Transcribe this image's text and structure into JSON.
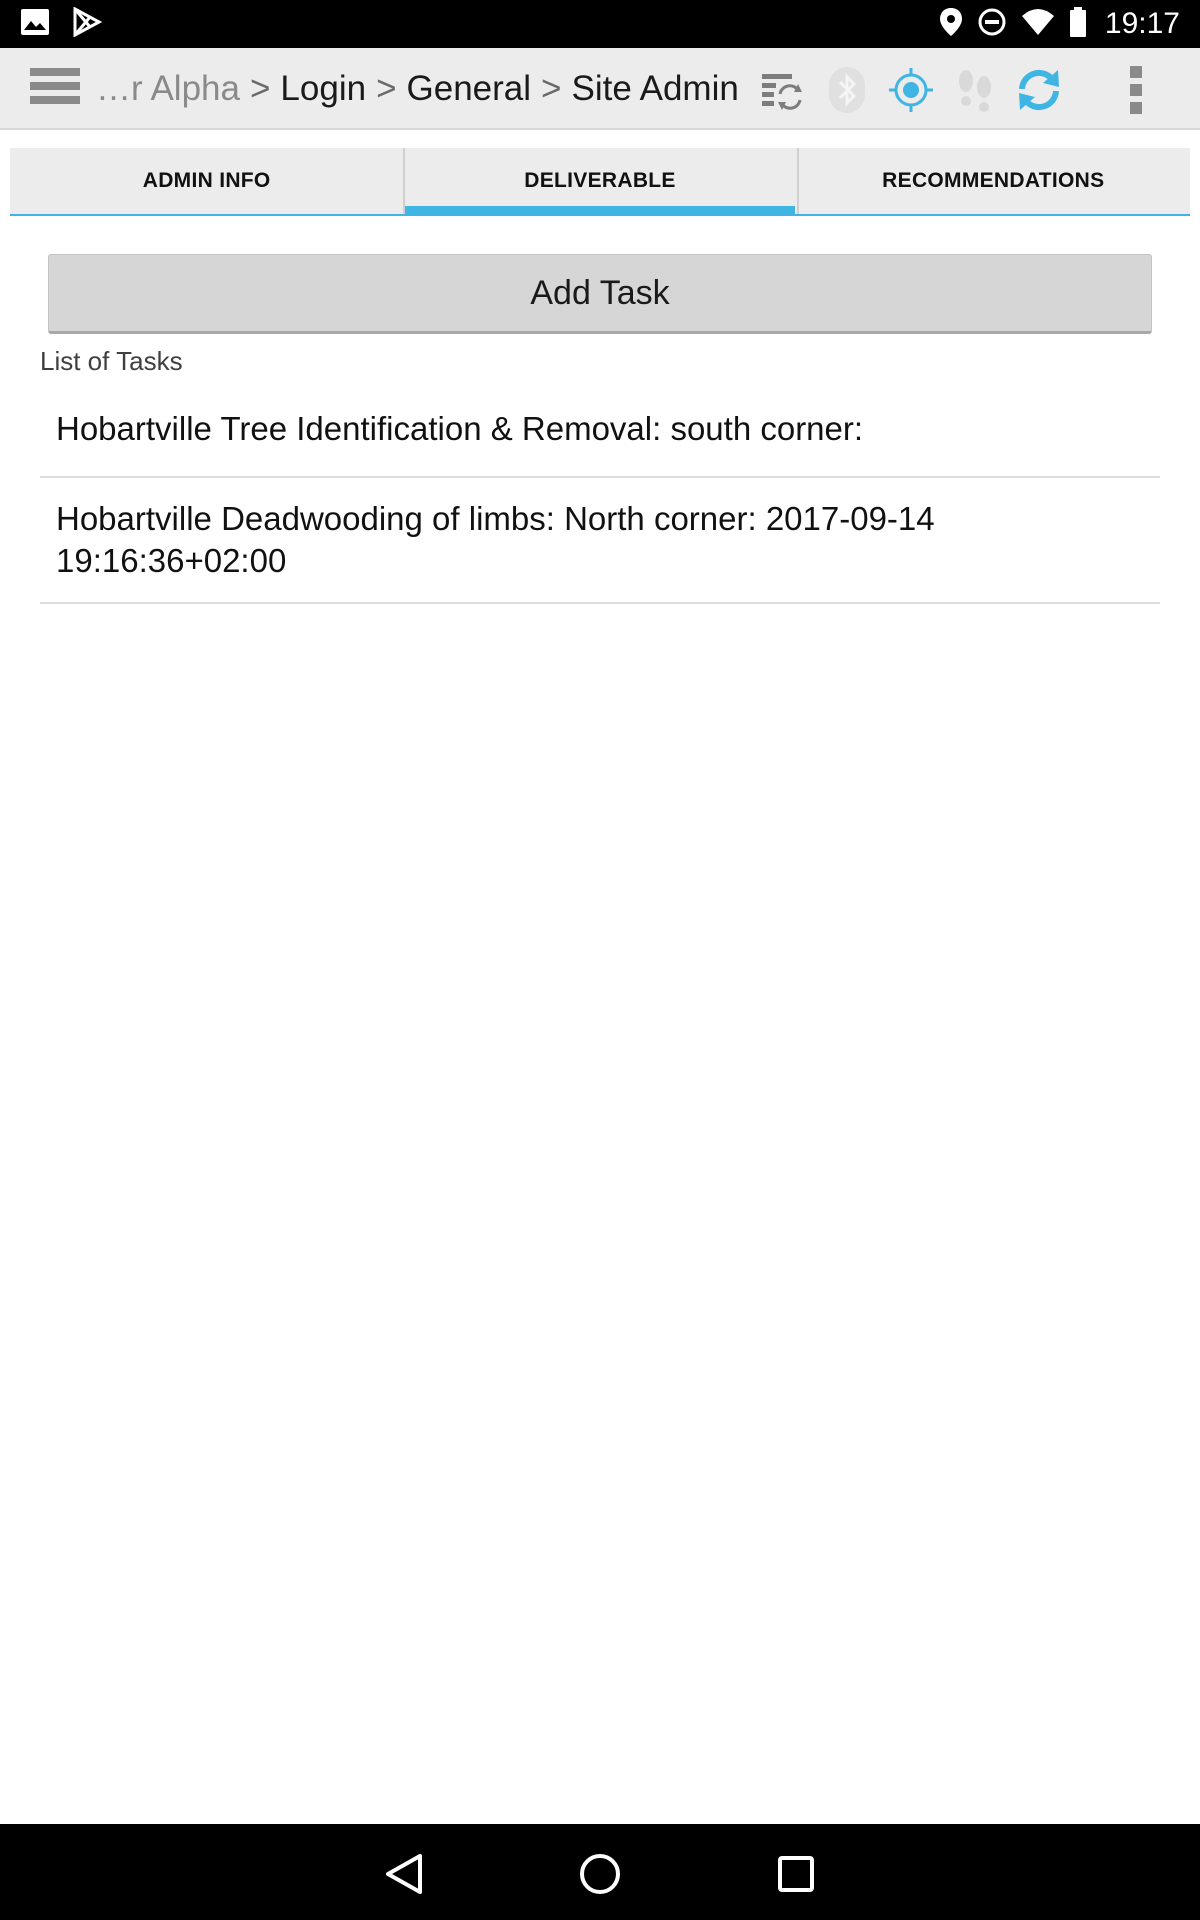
{
  "status_bar": {
    "time": "19:17",
    "icons": [
      "image-icon",
      "play-store-icon",
      "location-icon",
      "do-not-disturb-icon",
      "wifi-icon",
      "battery-icon"
    ]
  },
  "app_bar": {
    "breadcrumb": {
      "truncated": "…r Alpha",
      "separator": ">",
      "items": [
        "Login",
        "General",
        "Site Admin"
      ]
    },
    "icons": [
      "menu-icon",
      "sync-list-icon",
      "bluetooth-icon",
      "gps-target-icon",
      "footsteps-icon",
      "refresh-icon",
      "overflow-menu-icon"
    ],
    "accent_color": "#3fb5e4",
    "disabled_icon_color": "#d0d0d0"
  },
  "tabs": [
    {
      "label": "ADMIN INFO",
      "active": false
    },
    {
      "label": "DELIVERABLE",
      "active": true
    },
    {
      "label": "RECOMMENDATIONS",
      "active": false
    }
  ],
  "main": {
    "add_task_label": "Add Task",
    "list_title": "List of Tasks",
    "tasks": [
      "Hobartville Tree Identification & Removal: south corner:",
      "Hobartville Deadwooding of limbs: North corner: 2017-09-14 19:16:36+02:00"
    ]
  },
  "nav_bar": {
    "icons": [
      "back-icon",
      "home-icon",
      "recents-icon"
    ]
  }
}
